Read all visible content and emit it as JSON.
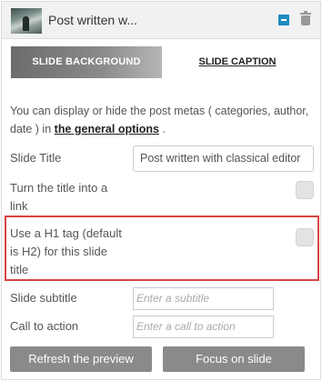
{
  "header": {
    "title": "Post written w...",
    "thumbnail_icon": "slide-thumbnail",
    "collapse_icon": "minus-square-icon",
    "delete_icon": "trash-icon"
  },
  "tabs": {
    "background": "SLIDE BACKGROUND",
    "caption": "SLIDE CAPTION"
  },
  "info": {
    "text": "You can display or hide the post metas ( categories, author, date ) in",
    "link": "the general options",
    "suffix": " ."
  },
  "fields": {
    "slide_title_label": "Slide Title",
    "slide_title_value": "Post written with classical editor",
    "title_link_label": "Turn the title into a link",
    "h1_tag_label": "Use a H1 tag (default is H2) for this slide title",
    "subtitle_label": "Slide subtitle",
    "subtitle_placeholder": "Enter a subtitle",
    "cta_label": "Call to action",
    "cta_placeholder": "Enter a call to action"
  },
  "buttons": {
    "refresh": "Refresh the preview",
    "focus": "Focus on slide"
  },
  "colors": {
    "accent": "#1e8cbe",
    "highlight_border": "#d64545",
    "button_bg": "#8a8a8a"
  }
}
